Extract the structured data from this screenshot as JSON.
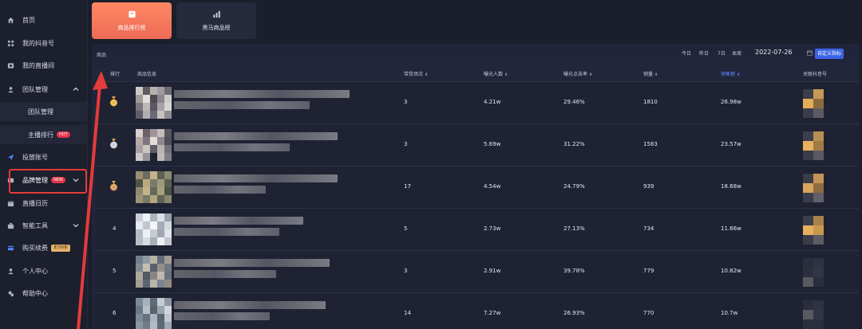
{
  "sidebar": {
    "items": [
      {
        "label": "首页",
        "icon": "home-icon"
      },
      {
        "label": "我的抖音号",
        "icon": "account-icon"
      },
      {
        "label": "我的直播间",
        "icon": "live-room-icon"
      },
      {
        "label": "团队管理",
        "icon": "team-icon"
      },
      {
        "label": "团队管理",
        "icon": ""
      },
      {
        "label": "主播排行",
        "badge": "HOT"
      },
      {
        "label": "投放账号",
        "icon": "send-icon"
      },
      {
        "label": "品牌管理",
        "icon": "brand-icon",
        "badge": "NEW"
      },
      {
        "label": "直播日历",
        "icon": "calendar-icon"
      },
      {
        "label": "智能工具",
        "icon": "tools-icon"
      },
      {
        "label": "购买续费",
        "icon": "card-icon",
        "badge": "年付6折"
      },
      {
        "label": "个人中心",
        "icon": "user-icon"
      },
      {
        "label": "帮助中心",
        "icon": "help-icon"
      }
    ]
  },
  "tabs": [
    {
      "label": "商品排行榜",
      "active": true
    },
    {
      "label": "黑马商品榜",
      "active": false
    }
  ],
  "panel": {
    "title": "商品",
    "ranges": [
      "今日",
      "昨日",
      "7日",
      "本周"
    ],
    "date": "2022-07-26",
    "custom_button": "自定义指标"
  },
  "table": {
    "headers": [
      "排行",
      "商品信息",
      "带货场次",
      "曝光人数",
      "曝光点击率",
      "销量",
      "销售额",
      "关联抖音号"
    ],
    "active_sort": "销售额",
    "rows": [
      {
        "rank": "1",
        "medal": "gold",
        "sessions": "3",
        "exposure": "4.21w",
        "ctr": "29.46%",
        "sales": "1810",
        "revenue": "26.98w"
      },
      {
        "rank": "2",
        "medal": "silver",
        "sessions": "3",
        "exposure": "5.69w",
        "ctr": "31.22%",
        "sales": "1583",
        "revenue": "23.57w"
      },
      {
        "rank": "3",
        "medal": "bronze",
        "sessions": "17",
        "exposure": "4.54w",
        "ctr": "24.79%",
        "sales": "939",
        "revenue": "18.68w"
      },
      {
        "rank": "4",
        "medal": "",
        "sessions": "5",
        "exposure": "2.73w",
        "ctr": "27.13%",
        "sales": "734",
        "revenue": "11.66w"
      },
      {
        "rank": "5",
        "medal": "",
        "sessions": "3",
        "exposure": "2.91w",
        "ctr": "39.78%",
        "sales": "779",
        "revenue": "10.82w"
      },
      {
        "rank": "6",
        "medal": "",
        "sessions": "14",
        "exposure": "7.27w",
        "ctr": "26.93%",
        "sales": "770",
        "revenue": "10.7w"
      }
    ]
  },
  "colors": {
    "accent": "#3c63e6",
    "tab_active": "#ff7b5e",
    "hot_badge": "#e2344a",
    "annotation": "#e43b3b",
    "gold": "#e7b53a",
    "silver": "#c9ccd4",
    "bronze": "#d4914e"
  }
}
